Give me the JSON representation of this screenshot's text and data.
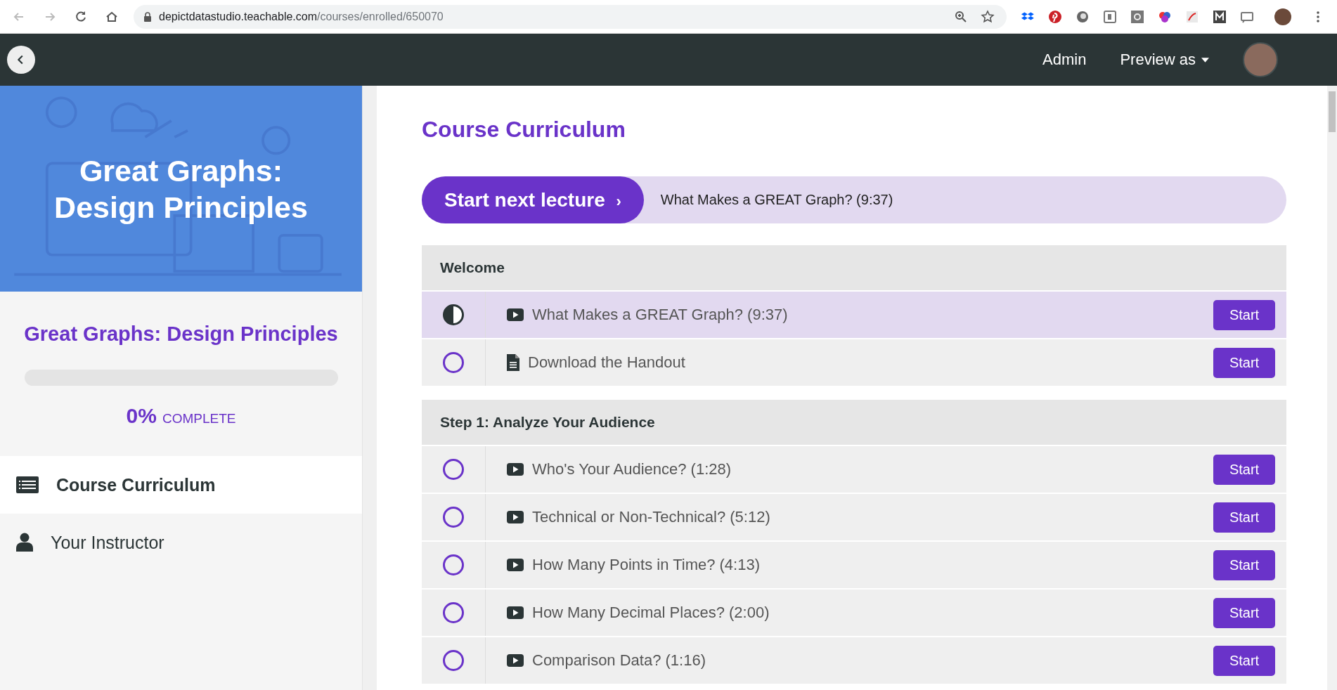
{
  "browser": {
    "url_host": "depictdatastudio.teachable.com",
    "url_path": "/courses/enrolled/650070"
  },
  "header": {
    "admin": "Admin",
    "preview": "Preview as"
  },
  "sidebar": {
    "banner_title": "Great Graphs: Design Principles",
    "course_title": "Great Graphs: Design Principles",
    "progress": {
      "level": 0,
      "percent": "0%",
      "label": "COMPLETE"
    },
    "nav": [
      {
        "label": "Course Curriculum",
        "selected": true
      },
      {
        "label": "Your Instructor",
        "selected": false
      }
    ]
  },
  "main": {
    "title": "Course Curriculum",
    "next": {
      "button": "Start next lecture",
      "arrow": "›",
      "lecture": "What Makes a GREAT Graph? (9:37)"
    },
    "sections": [
      {
        "title": "Welcome",
        "lectures": [
          {
            "selected": true,
            "started": true,
            "kind": "video",
            "title": "What Makes a GREAT Graph? (9:37)",
            "button": "Start"
          },
          {
            "selected": false,
            "started": false,
            "kind": "document",
            "title": "Download the Handout",
            "button": "Start"
          }
        ]
      },
      {
        "title": "Step 1: Analyze Your Audience",
        "lectures": [
          {
            "selected": false,
            "started": false,
            "kind": "video",
            "title": "Who's Your Audience? (1:28)",
            "button": "Start"
          },
          {
            "selected": false,
            "started": false,
            "kind": "video",
            "title": "Technical or Non-Technical? (5:12)",
            "button": "Start"
          },
          {
            "selected": false,
            "started": false,
            "kind": "video",
            "title": "How Many Points in Time? (4:13)",
            "button": "Start"
          },
          {
            "selected": false,
            "started": false,
            "kind": "video",
            "title": "How Many Decimal Places? (2:00)",
            "button": "Start"
          },
          {
            "selected": false,
            "started": false,
            "kind": "video",
            "title": "Comparison Data? (1:16)",
            "button": "Start"
          }
        ]
      }
    ]
  }
}
